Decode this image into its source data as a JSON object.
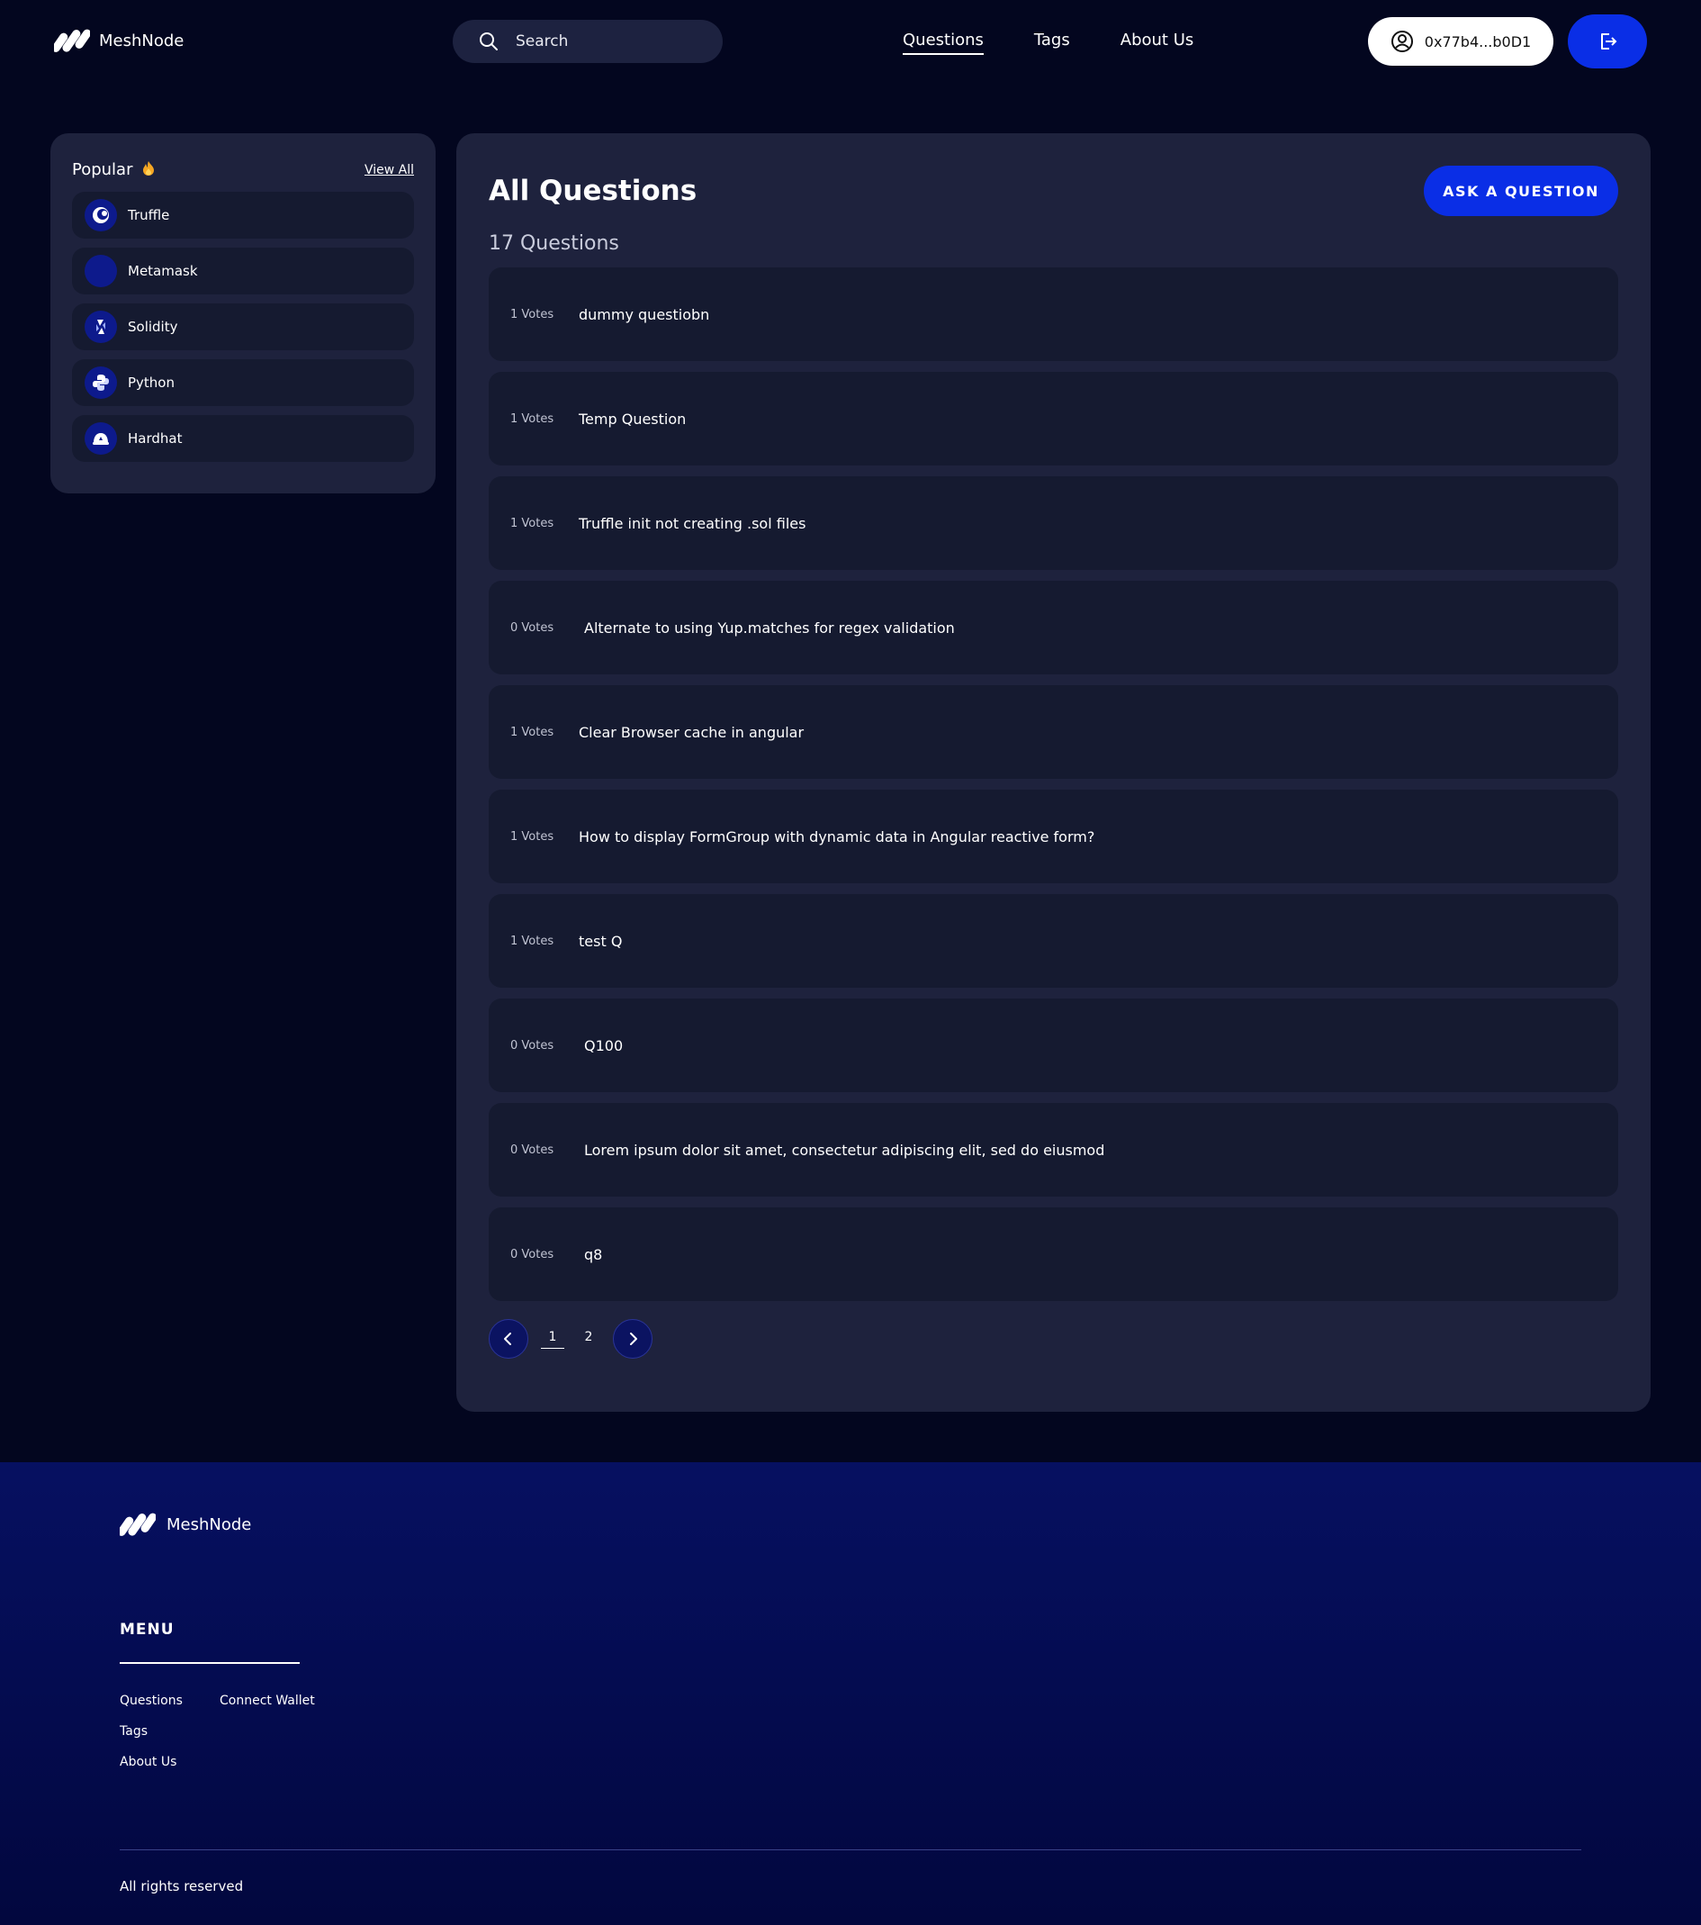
{
  "header": {
    "brand": "MeshNode",
    "search_placeholder": "Search",
    "nav": [
      "Questions",
      "Tags",
      "About Us"
    ],
    "wallet_address": "0x77b4...b0D1"
  },
  "sidebar": {
    "title": "Popular",
    "view_all": "View All",
    "items": [
      {
        "label": "Truffle",
        "icon": "truffle-icon"
      },
      {
        "label": "Metamask",
        "icon": "metamask-icon"
      },
      {
        "label": "Solidity",
        "icon": "solidity-icon"
      },
      {
        "label": "Python",
        "icon": "python-icon"
      },
      {
        "label": "Hardhat",
        "icon": "hardhat-icon"
      }
    ]
  },
  "main": {
    "title": "All Questions",
    "ask_button": "ASK A QUESTION",
    "count": "17 Questions",
    "questions": [
      {
        "votes": "1 Votes",
        "title": "dummy questiobn"
      },
      {
        "votes": "1 Votes",
        "title": "Temp Question"
      },
      {
        "votes": "1 Votes",
        "title": "Truffle init not creating .sol files"
      },
      {
        "votes": "0 Votes",
        "title": "Alternate to using Yup.matches for regex validation"
      },
      {
        "votes": "1 Votes",
        "title": "Clear Browser cache in angular"
      },
      {
        "votes": "1 Votes",
        "title": "How to display FormGroup with dynamic data in Angular reactive form?"
      },
      {
        "votes": "1 Votes",
        "title": "test Q"
      },
      {
        "votes": "0 Votes",
        "title": "Q100"
      },
      {
        "votes": "0 Votes",
        "title": "Lorem ipsum dolor sit amet, consectetur adipiscing elit, sed do eiusmod"
      },
      {
        "votes": "0 Votes",
        "title": "q8"
      }
    ],
    "pages": [
      "1",
      "2"
    ],
    "current_page": "1"
  },
  "footer": {
    "brand": "MeshNode",
    "menu_title": "MENU",
    "links": [
      "Questions",
      "Connect Wallet",
      "Tags",
      "About Us"
    ],
    "copyright": "All rights reserved"
  },
  "colors": {
    "background": "#03061f",
    "panel": "#1e223d",
    "card": "#151a30",
    "accent": "#0a2ee6",
    "footer": "#061061"
  }
}
